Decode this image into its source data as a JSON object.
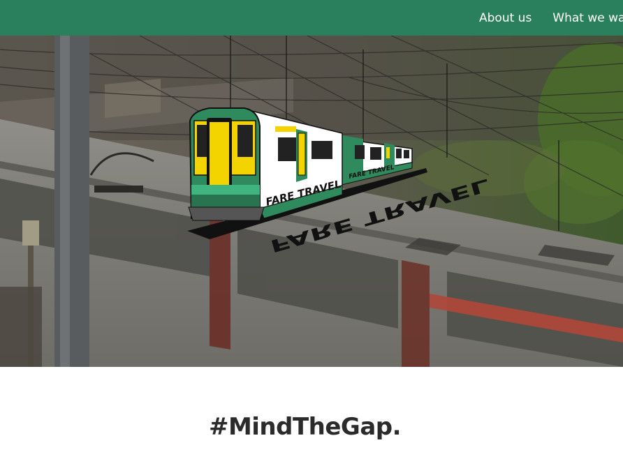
{
  "nav": {
    "items": [
      {
        "label": "About us"
      },
      {
        "label": "What we war"
      }
    ]
  },
  "hero": {
    "logo": {
      "car_text": "FARE TRAVEL",
      "shadow_text": "FARE TRAVEL"
    }
  },
  "main": {
    "heading": "#MindTheGap."
  },
  "colors": {
    "nav_bg": "#2a7f5c",
    "train_green": "#2f8a5e",
    "train_yellow": "#f3d300",
    "heading_text": "#2b2b2b"
  },
  "icons": {
    "logo": "train-logo-icon"
  }
}
